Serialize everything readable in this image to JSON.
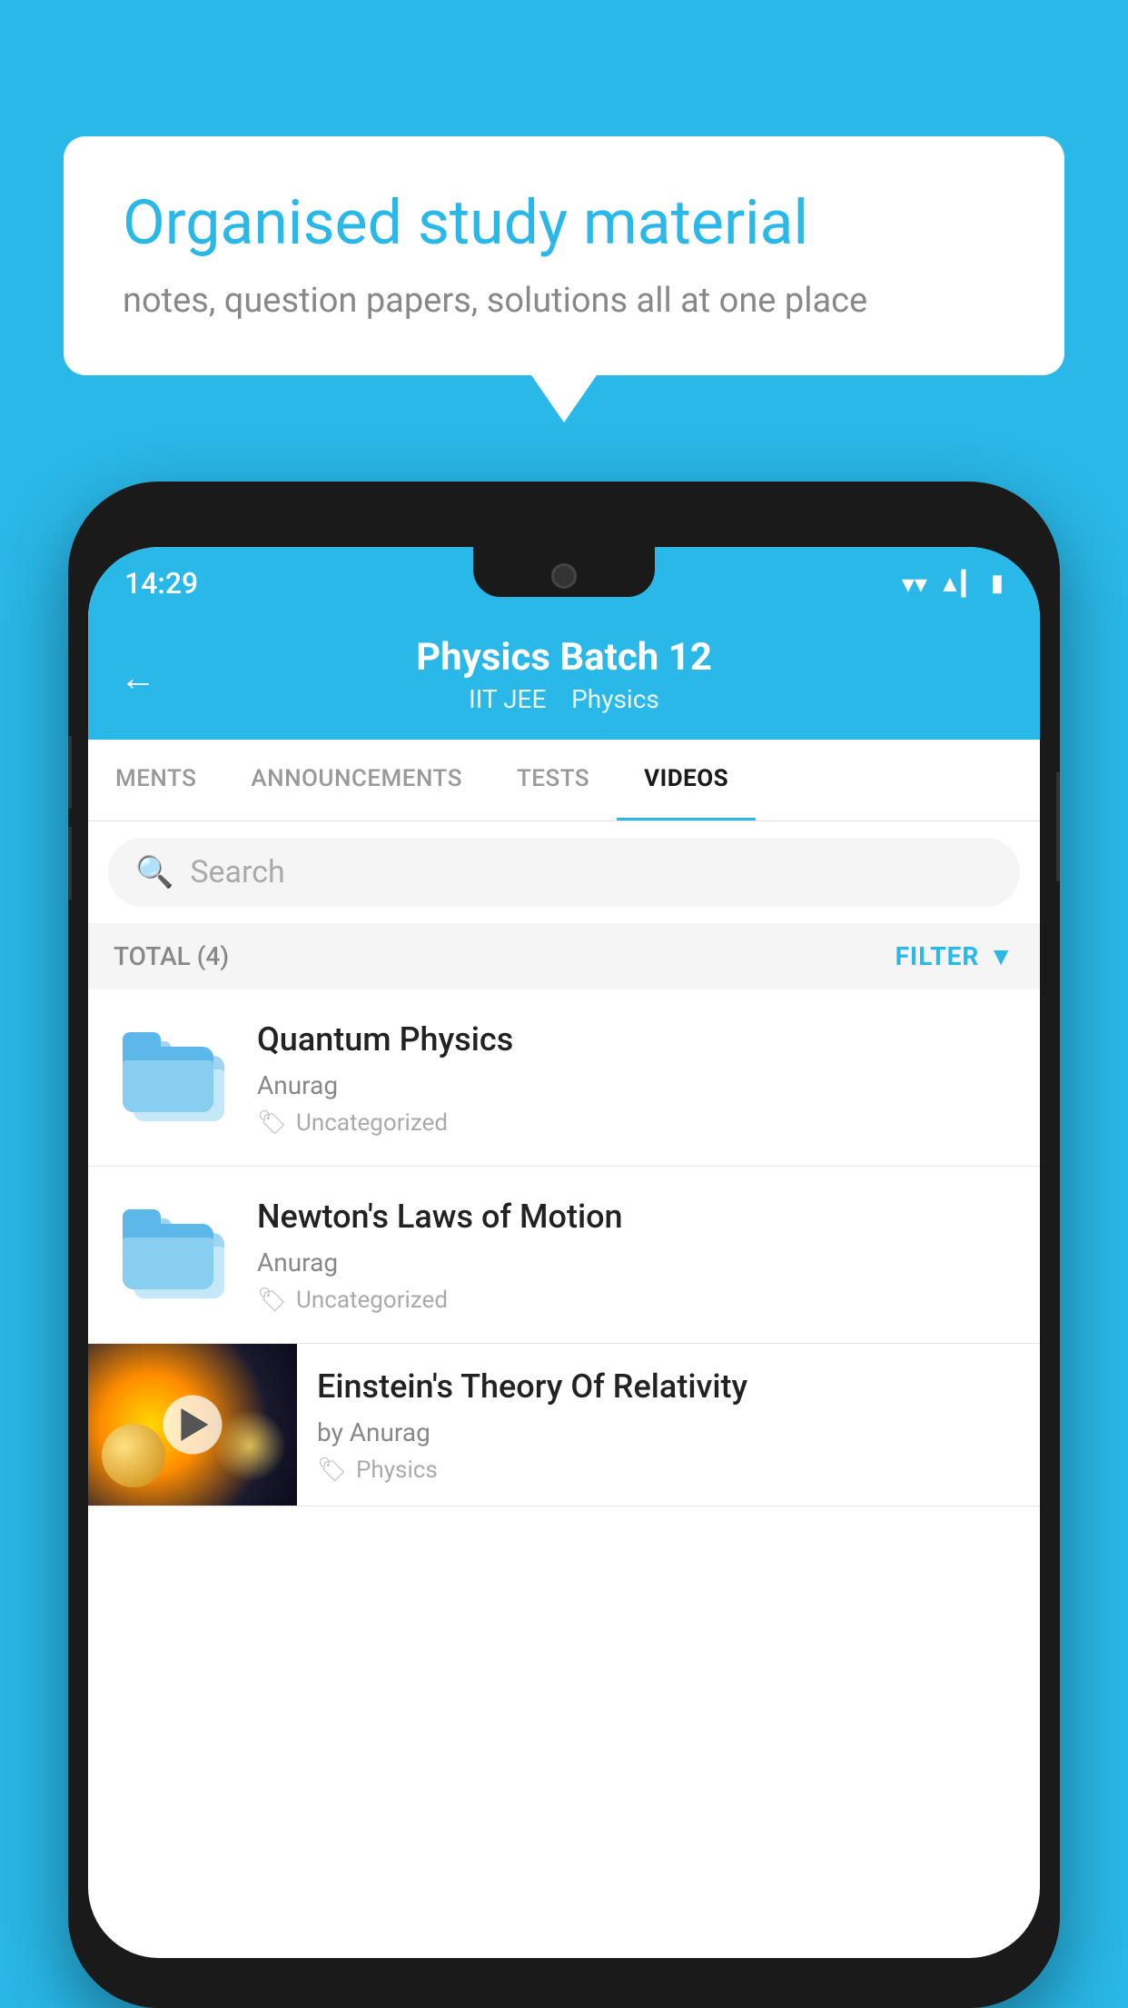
{
  "background_color": "#29b8e8",
  "speech_bubble": {
    "heading": "Organised study material",
    "subtext": "notes, question papers, solutions all at one place"
  },
  "phone": {
    "status_bar": {
      "time": "14:29",
      "wifi": "▼",
      "signal": "▲",
      "battery": "▮"
    },
    "header": {
      "back_label": "←",
      "title": "Physics Batch 12",
      "subtitle_part1": "IIT JEE",
      "subtitle_part2": "Physics"
    },
    "tabs": [
      {
        "label": "MENTS",
        "active": false
      },
      {
        "label": "ANNOUNCEMENTS",
        "active": false
      },
      {
        "label": "TESTS",
        "active": false
      },
      {
        "label": "VIDEOS",
        "active": true
      }
    ],
    "search": {
      "placeholder": "Search"
    },
    "filter_row": {
      "total_label": "TOTAL (4)",
      "filter_label": "FILTER"
    },
    "videos": [
      {
        "title": "Quantum Physics",
        "author": "Anurag",
        "tag": "Uncategorized",
        "type": "folder"
      },
      {
        "title": "Newton's Laws of Motion",
        "author": "Anurag",
        "tag": "Uncategorized",
        "type": "folder"
      },
      {
        "title": "Einstein's Theory Of Relativity",
        "author": "by Anurag",
        "tag": "Physics",
        "type": "thumb"
      }
    ]
  }
}
